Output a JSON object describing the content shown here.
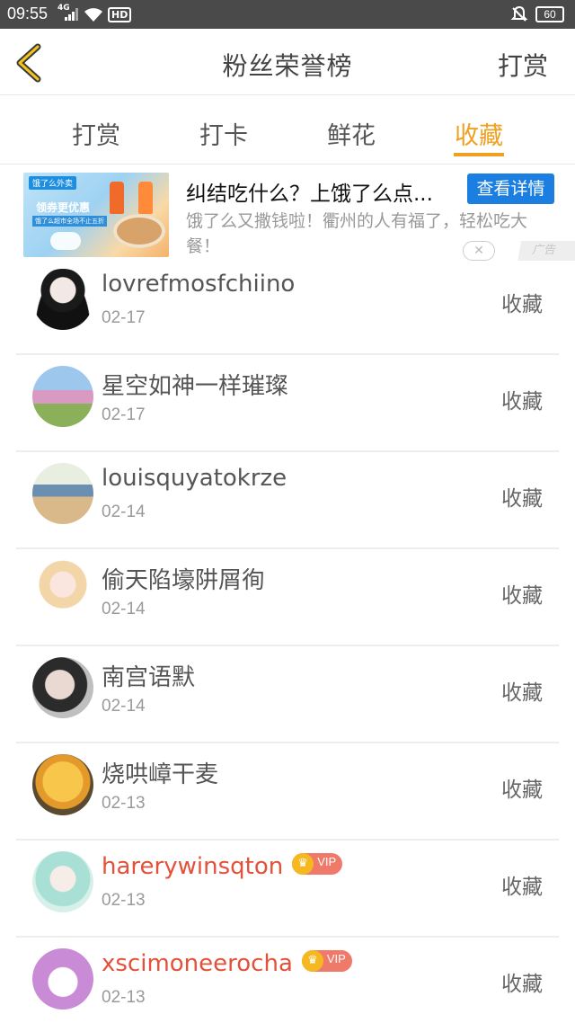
{
  "status_bar": {
    "time": "09:55",
    "network": "4G",
    "hd": "HD",
    "battery": "60"
  },
  "header": {
    "title": "粉丝荣誉榜",
    "right_action": "打赏"
  },
  "tabs": [
    {
      "label": "打赏",
      "active": false
    },
    {
      "label": "打卡",
      "active": false
    },
    {
      "label": "鲜花",
      "active": false
    },
    {
      "label": "收藏",
      "active": true
    }
  ],
  "ad": {
    "image_brand": "饿了么外卖",
    "image_coupon_text": "领券更优惠",
    "image_sub_text": "饿了么超市全场不止五折",
    "title": "纠结吃什么？上饿了么点...",
    "detail_button": "查看详情",
    "description": "饿了么又撒钱啦！衢州的人有福了，轻松吃大餐！",
    "close_symbol": "✕",
    "tag": "广告"
  },
  "colors": {
    "accent": "#f0a020",
    "vip_name": "#e4513a",
    "ad_button": "#1a7fe0"
  },
  "fans": [
    {
      "name": "lovrefmosfchiino",
      "date": "02-17",
      "action": "收藏",
      "vip": false,
      "vip_label": ""
    },
    {
      "name": "星空如神一样璀璨",
      "date": "02-17",
      "action": "收藏",
      "vip": false,
      "vip_label": ""
    },
    {
      "name": "louisquyatokrze",
      "date": "02-14",
      "action": "收藏",
      "vip": false,
      "vip_label": ""
    },
    {
      "name": "偷天陷壕阱屑徇",
      "date": "02-14",
      "action": "收藏",
      "vip": false,
      "vip_label": ""
    },
    {
      "name": "南宫语默",
      "date": "02-14",
      "action": "收藏",
      "vip": false,
      "vip_label": ""
    },
    {
      "name": "烧哄嶂干麦",
      "date": "02-13",
      "action": "收藏",
      "vip": false,
      "vip_label": ""
    },
    {
      "name": "harerywinsqton",
      "date": "02-13",
      "action": "收藏",
      "vip": true,
      "vip_label": "VIP"
    },
    {
      "name": "xscimoneerocha",
      "date": "02-13",
      "action": "收藏",
      "vip": true,
      "vip_label": "VIP"
    }
  ]
}
